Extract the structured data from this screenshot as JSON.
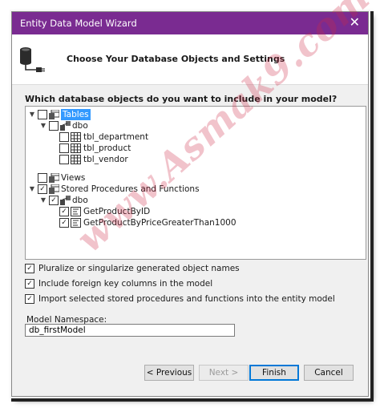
{
  "window": {
    "title": "Entity Data Model Wizard",
    "close_glyph": "✕"
  },
  "header": {
    "heading": "Choose Your Database Objects and Settings"
  },
  "question": "Which database objects do you want to include in your model?",
  "tree": {
    "tables": "Tables",
    "tables_schema": "dbo",
    "tables_items": [
      "tbl_department",
      "tbl_product",
      "tbl_vendor"
    ],
    "views": "Views",
    "procs": "Stored Procedures and Functions",
    "procs_schema": "dbo",
    "procs_items": [
      "GetProductByID",
      "GetProductByPriceGreaterThan1000"
    ]
  },
  "options": {
    "pluralize": "Pluralize or singularize generated object names",
    "foreign_keys": "Include foreign key columns in the model",
    "import_procs": "Import selected stored procedures and functions into the entity model"
  },
  "namespace": {
    "label": "Model Namespace:",
    "value": "db_firstModel"
  },
  "buttons": {
    "previous": "< Previous",
    "next": "Next >",
    "finish": "Finish",
    "cancel": "Cancel"
  },
  "watermark": "www.Asmak9.com",
  "colors": {
    "titlebar": "#7a2b91",
    "selection": "#3399ff",
    "primary_border": "#0078d7"
  }
}
